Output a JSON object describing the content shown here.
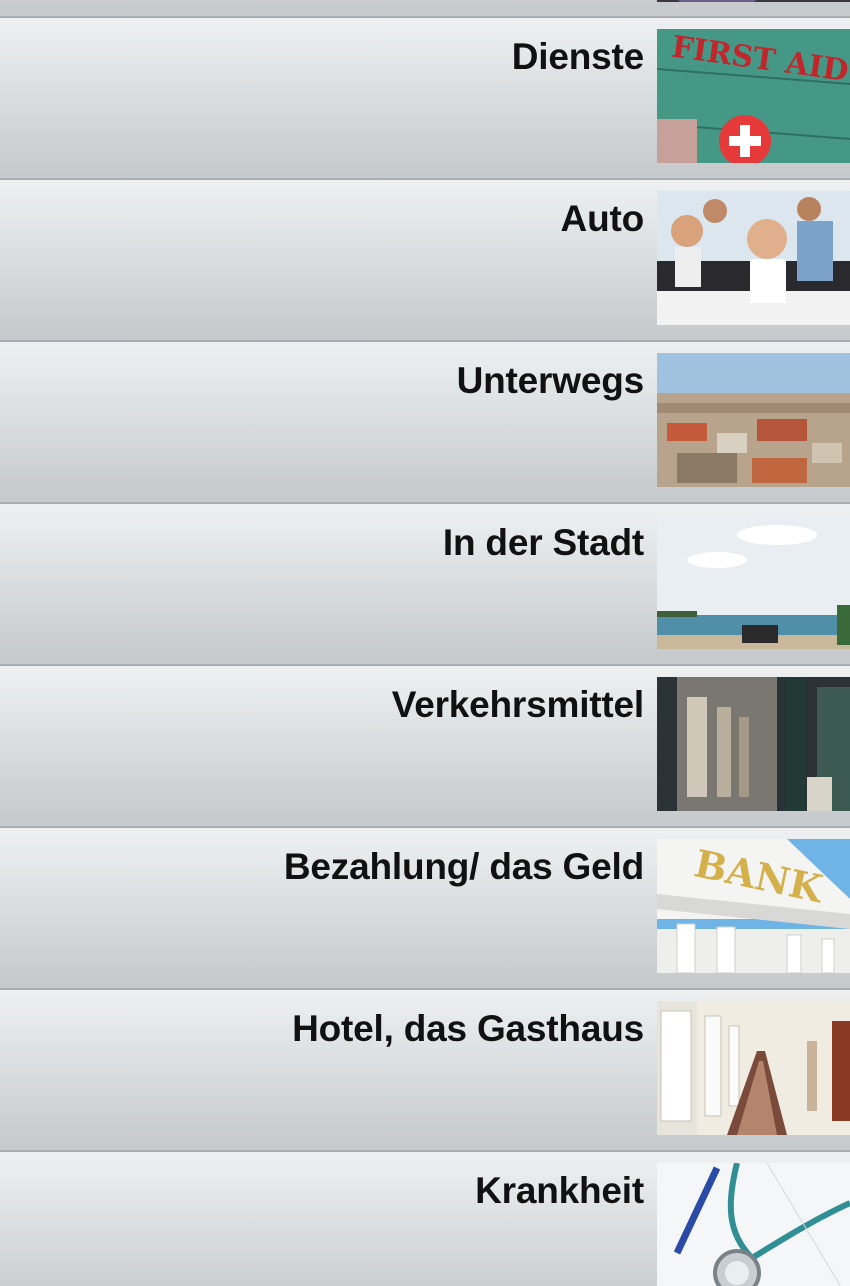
{
  "list": {
    "items": [
      {
        "label": "",
        "icon": "partial-thumbnail-image"
      },
      {
        "label": "Dienste",
        "icon": "first-aid-case-image",
        "image_text": "FIRST AID CASE"
      },
      {
        "label": "Auto",
        "icon": "convertible-car-friends-image"
      },
      {
        "label": "Unterwegs",
        "icon": "city-panorama-image"
      },
      {
        "label": "In der Stadt",
        "icon": "beach-jeep-image"
      },
      {
        "label": "Verkehrsmittel",
        "icon": "subway-train-image"
      },
      {
        "label": "Bezahlung/ das Geld",
        "icon": "bank-building-image",
        "image_text": "BANK"
      },
      {
        "label": "Hotel, das Gasthaus",
        "icon": "hotel-corridor-image"
      },
      {
        "label": "Krankheit",
        "icon": "stethoscope-image"
      }
    ]
  },
  "colors": {
    "row_top": "#eef0f1",
    "row_bottom": "#c6c9cc",
    "divider": "#a9adb0",
    "label": "#111111"
  }
}
